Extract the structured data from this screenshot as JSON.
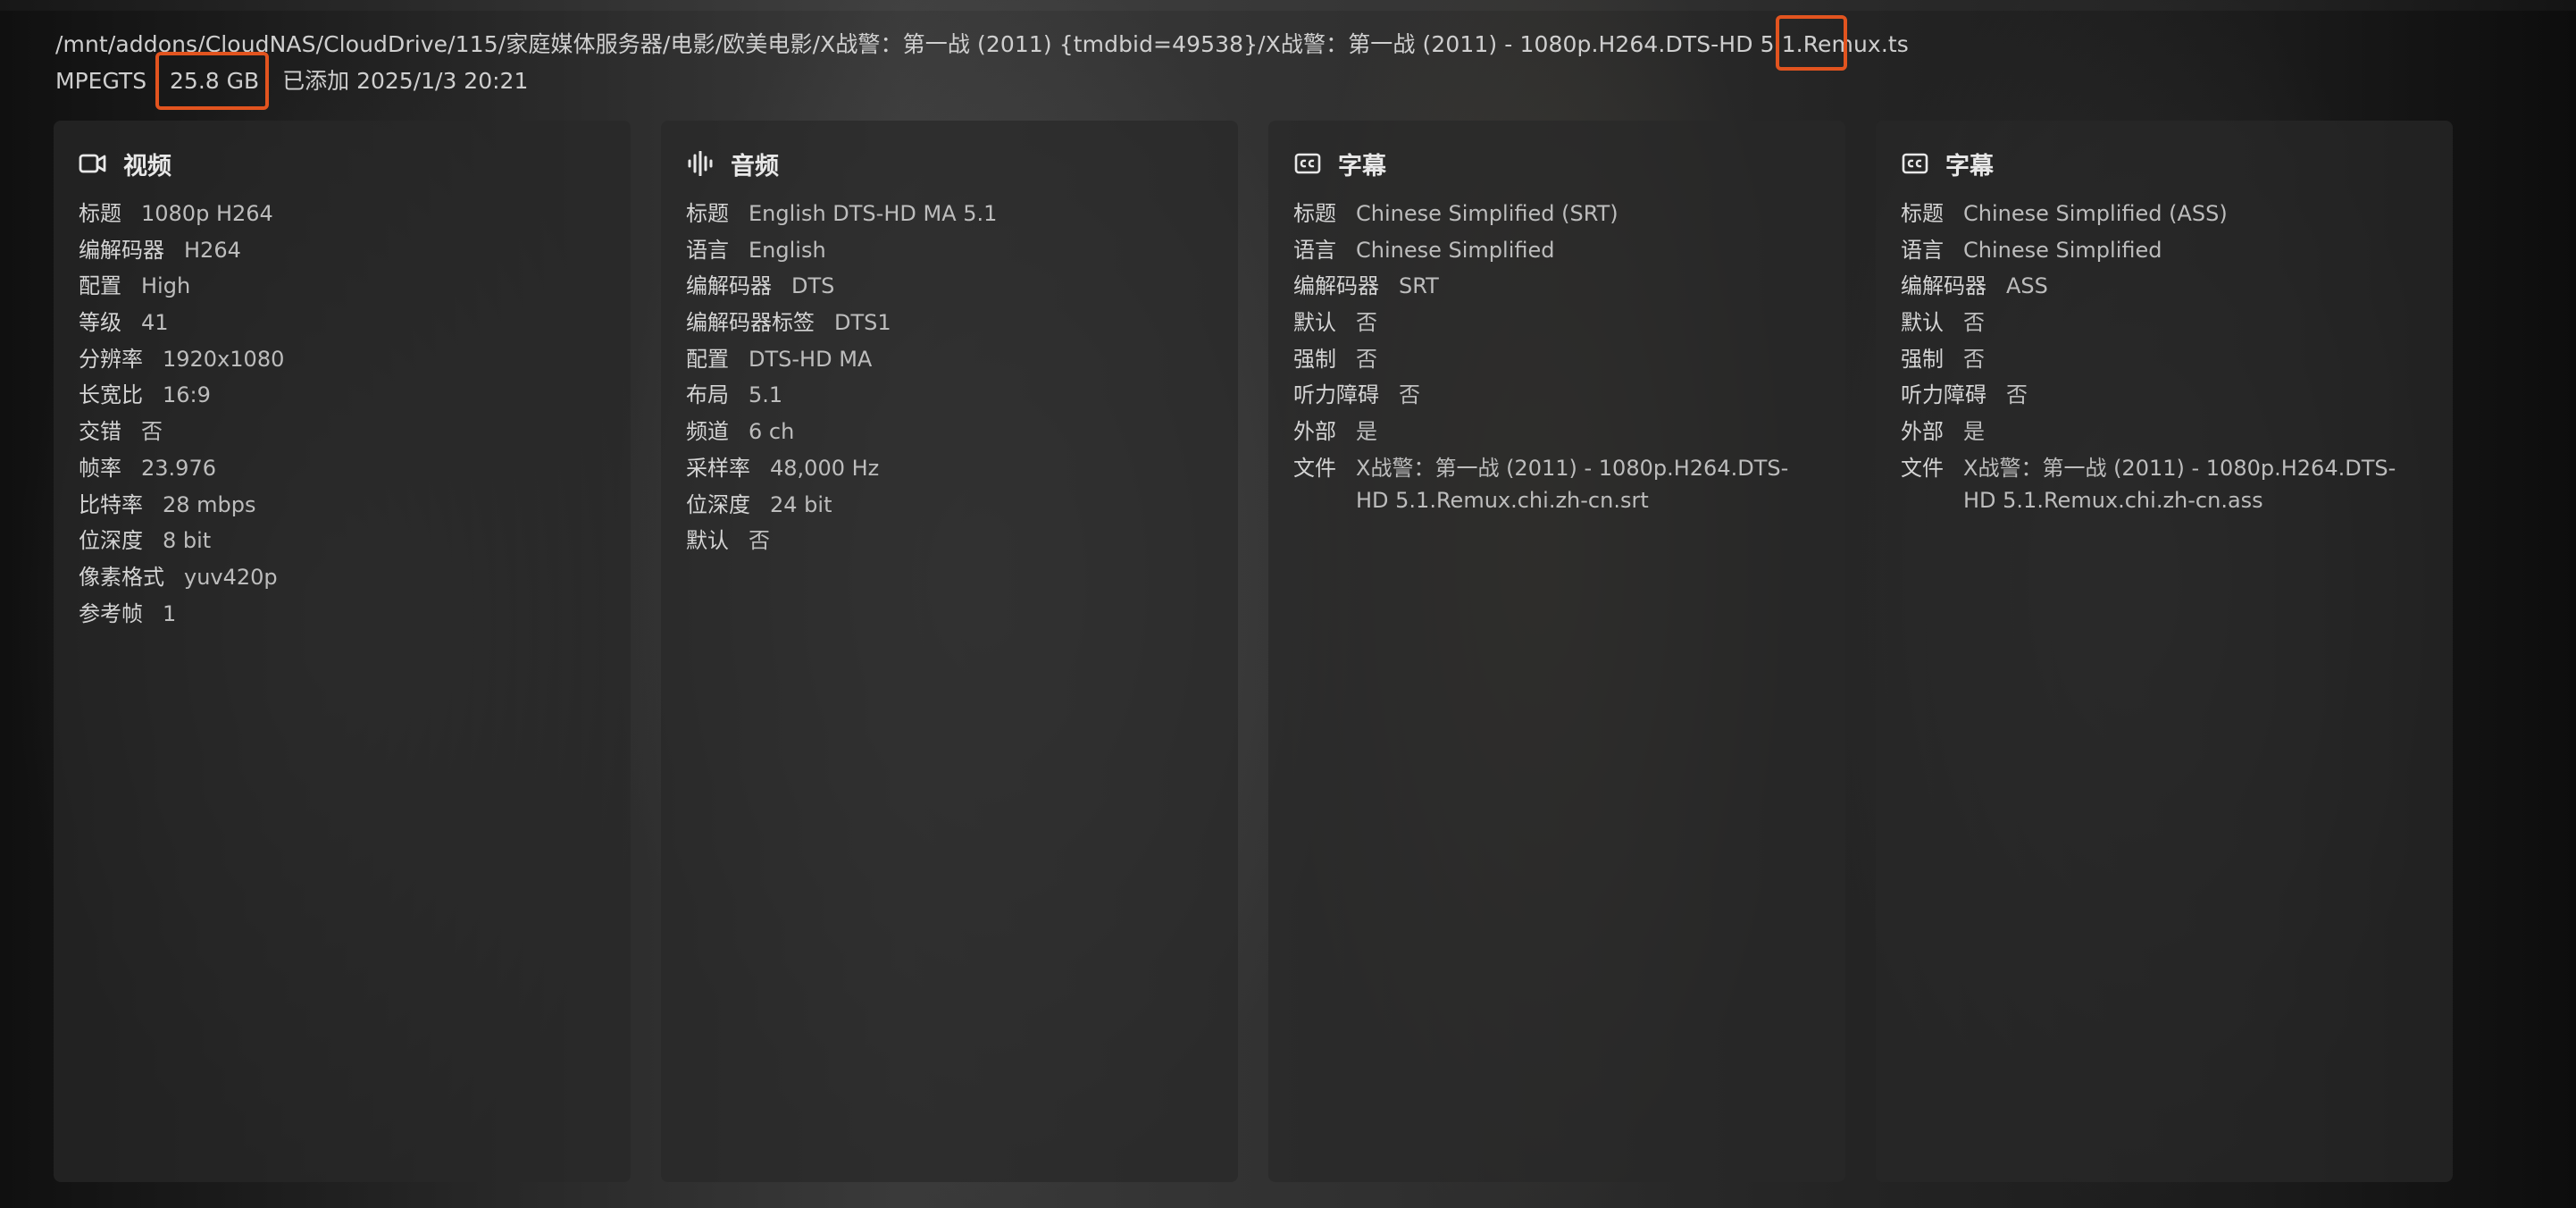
{
  "file": {
    "path": "/mnt/addons/CloudNAS/CloudDrive/115/家庭媒体服务器/电影/欧美电影/X战警：第一战 (2011) {tmdbid=49538}/X战警：第一战 (2011) - 1080p.H264.DTS-HD 5.1.Remux.ts",
    "container": "MPEGTS",
    "size": "25.8 GB",
    "added": "已添加 2025/1/3 20:21"
  },
  "highlight_color": "#e2541f",
  "panels": [
    {
      "title": "视频",
      "icon": "video-camera-icon",
      "rows": [
        {
          "k": "标题",
          "v": "1080p H264"
        },
        {
          "k": "编解码器",
          "v": "H264"
        },
        {
          "k": "配置",
          "v": "High"
        },
        {
          "k": "等级",
          "v": "41"
        },
        {
          "k": "分辨率",
          "v": "1920x1080"
        },
        {
          "k": "长宽比",
          "v": "16:9"
        },
        {
          "k": "交错",
          "v": "否"
        },
        {
          "k": "帧率",
          "v": "23.976"
        },
        {
          "k": "比特率",
          "v": "28 mbps"
        },
        {
          "k": "位深度",
          "v": "8 bit"
        },
        {
          "k": "像素格式",
          "v": "yuv420p"
        },
        {
          "k": "参考帧",
          "v": "1"
        }
      ]
    },
    {
      "title": "音频",
      "icon": "audio-waveform-icon",
      "rows": [
        {
          "k": "标题",
          "v": "English DTS-HD MA 5.1"
        },
        {
          "k": "语言",
          "v": "English"
        },
        {
          "k": "编解码器",
          "v": "DTS"
        },
        {
          "k": "编解码器标签",
          "v": "DTS1"
        },
        {
          "k": "配置",
          "v": "DTS-HD MA"
        },
        {
          "k": "布局",
          "v": "5.1"
        },
        {
          "k": "频道",
          "v": "6 ch"
        },
        {
          "k": "采样率",
          "v": "48,000 Hz"
        },
        {
          "k": "位深度",
          "v": "24 bit"
        },
        {
          "k": "默认",
          "v": "否"
        }
      ]
    },
    {
      "title": "字幕",
      "icon": "closed-caption-icon",
      "rows": [
        {
          "k": "标题",
          "v": "Chinese Simplified (SRT)"
        },
        {
          "k": "语言",
          "v": "Chinese Simplified"
        },
        {
          "k": "编解码器",
          "v": "SRT"
        },
        {
          "k": "默认",
          "v": "否"
        },
        {
          "k": "强制",
          "v": "否"
        },
        {
          "k": "听力障碍",
          "v": "否"
        },
        {
          "k": "外部",
          "v": "是"
        },
        {
          "k": "文件",
          "v": "X战警：第一战 (2011) - 1080p.H264.DTS-HD 5.1.Remux.chi.zh-cn.srt"
        }
      ]
    },
    {
      "title": "字幕",
      "icon": "closed-caption-icon",
      "rows": [
        {
          "k": "标题",
          "v": "Chinese Simplified (ASS)"
        },
        {
          "k": "语言",
          "v": "Chinese Simplified"
        },
        {
          "k": "编解码器",
          "v": "ASS"
        },
        {
          "k": "默认",
          "v": "否"
        },
        {
          "k": "强制",
          "v": "否"
        },
        {
          "k": "听力障碍",
          "v": "否"
        },
        {
          "k": "外部",
          "v": "是"
        },
        {
          "k": "文件",
          "v": "X战警：第一战 (2011) - 1080p.H264.DTS-HD 5.1.Remux.chi.zh-cn.ass"
        }
      ]
    }
  ]
}
